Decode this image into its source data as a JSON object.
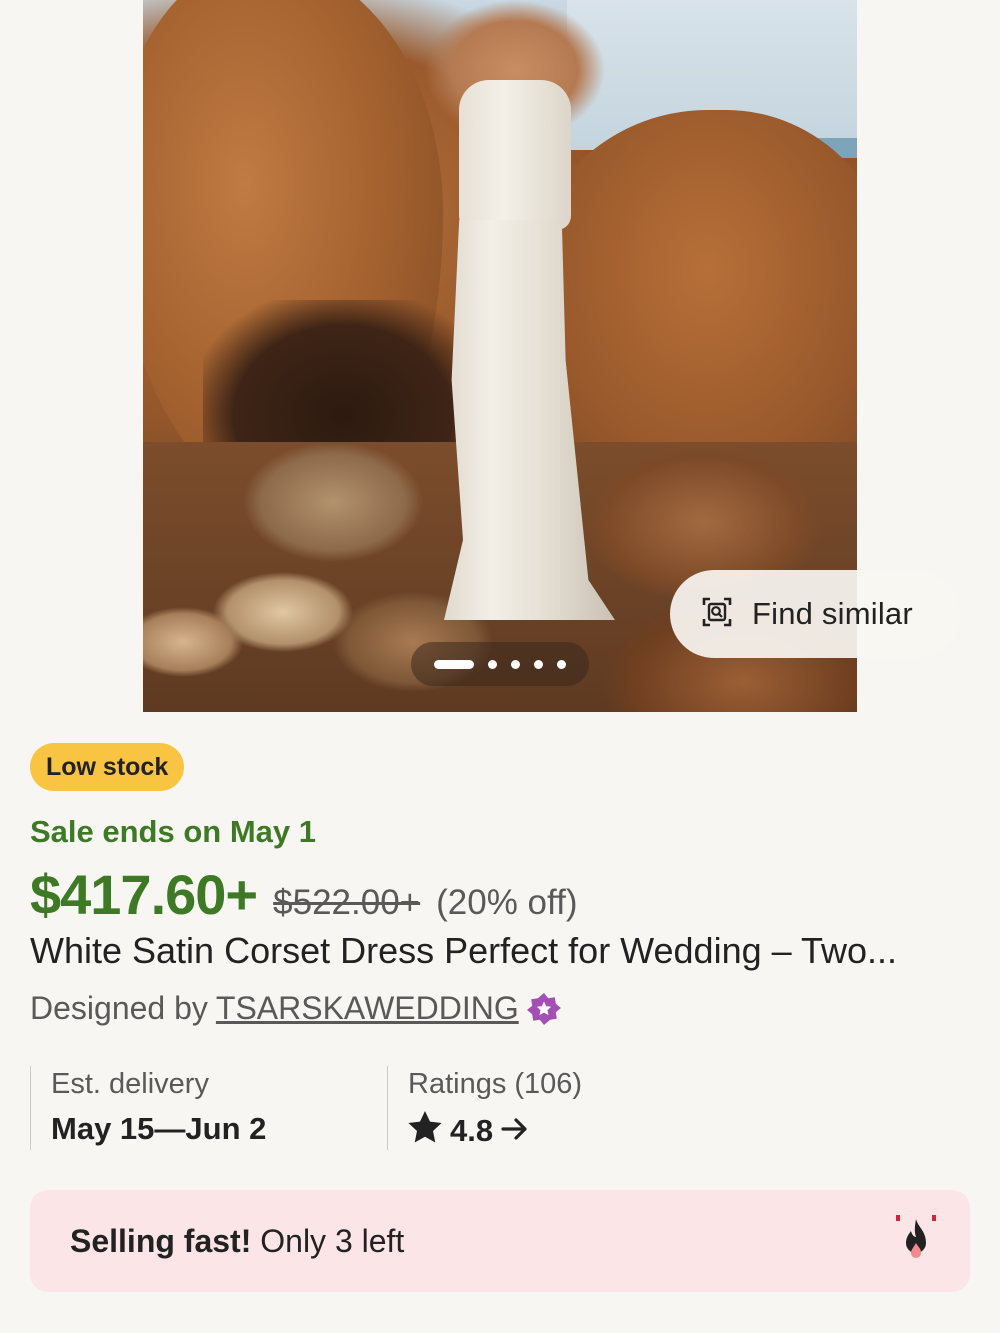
{
  "gallery": {
    "image_alt": "",
    "slide_count": 5,
    "active_slide": 1,
    "find_similar_label": "Find similar",
    "find_similar_icon": "image-search-icon"
  },
  "product": {
    "stock_badge": "Low stock",
    "sale_ends": "Sale ends on May 1",
    "price_now": "$417.60+",
    "price_was": "$522.00+",
    "discount": "(20% off)",
    "title": "White Satin Corset Dress Perfect for Wedding – Two...",
    "designed_by_label": "Designed by",
    "shop_name": "TSARSKAWEDDING",
    "star_seller_icon": "star-seller-badge-icon"
  },
  "facts": {
    "delivery_label": "Est. delivery",
    "delivery_value": "May 15—Jun 2",
    "ratings_label": "Ratings (106)",
    "ratings_value": "4.8",
    "ratings_icon": "star-icon",
    "ratings_arrow_icon": "arrow-right-icon"
  },
  "urgency": {
    "bold_text": "Selling fast!",
    "text": " Only 3 left",
    "icon": "fire-icon"
  },
  "colors": {
    "background": "#f8f6f2",
    "sale_green": "#3e7a26",
    "badge_yellow": "#f8c441",
    "urgency_bg": "#fbe5e7",
    "star_seller_purple": "#a34fb3"
  }
}
